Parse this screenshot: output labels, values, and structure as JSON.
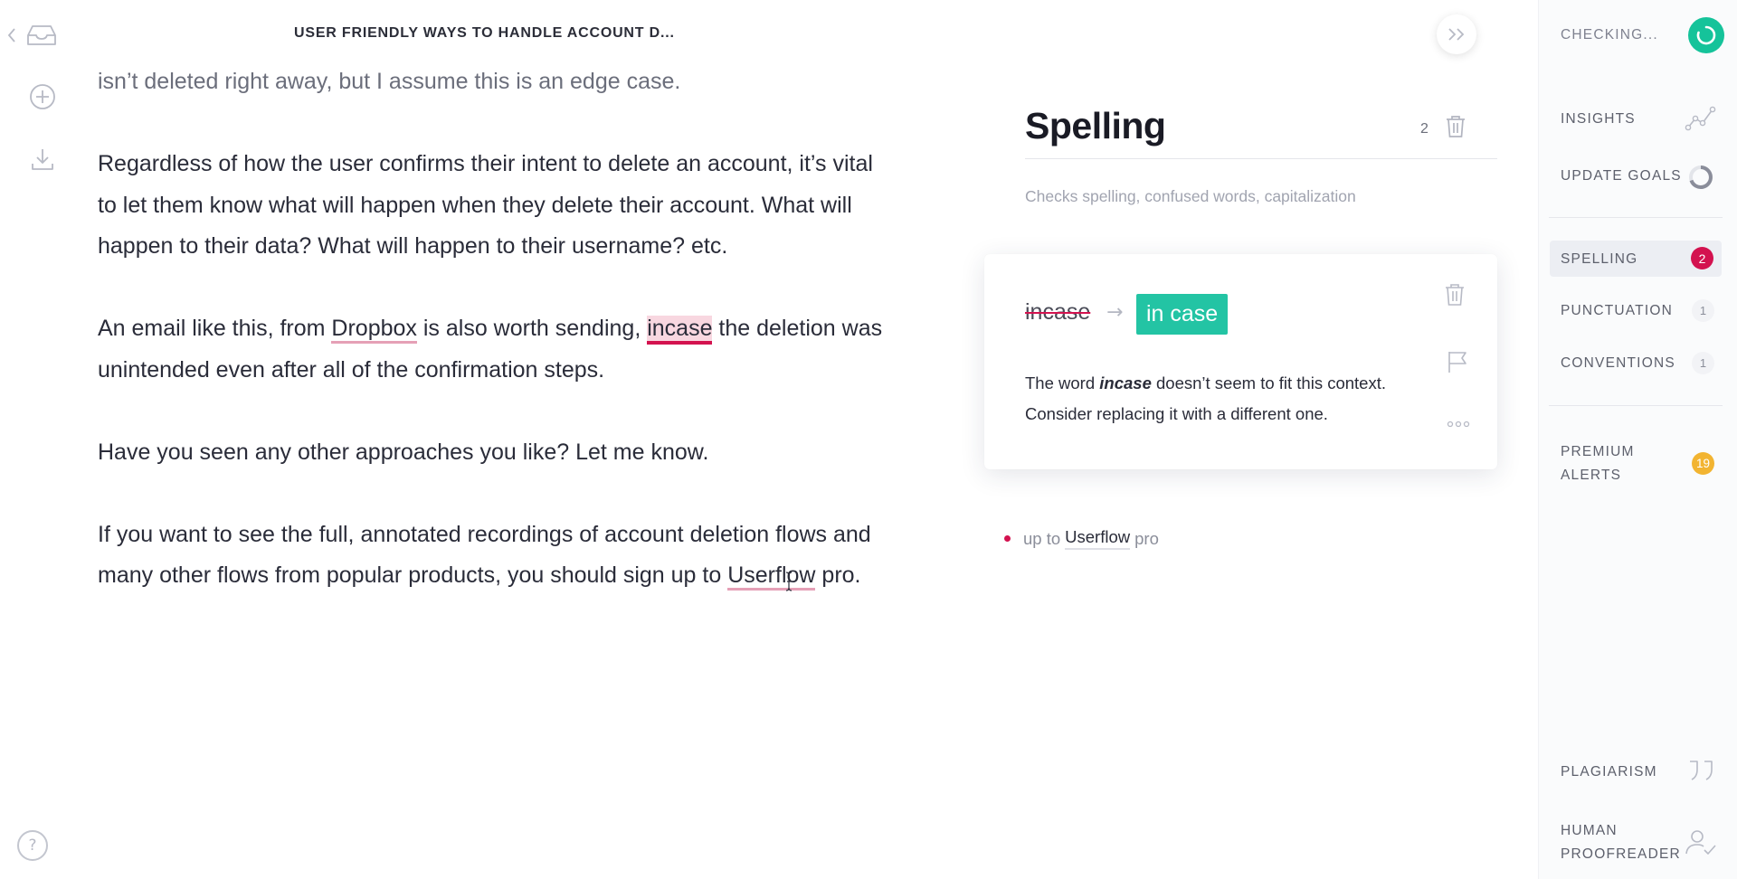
{
  "document": {
    "title": "USER FRIENDLY WAYS TO HANDLE ACCOUNT D...",
    "p0": "isn’t deleted right away, but I assume this is an edge case.",
    "p1": "Regardless of how the user confirms their intent to delete an account, it’s vital to let them know what will happen when they delete their account. What will happen to their data? What will happen to their username? etc.",
    "p2_a": "An email like this, from ",
    "p2_link": "Dropbox",
    "p2_b": " is also worth sending, ",
    "p2_err": "incase",
    "p2_c": " the deletion was unintended even after all of the confirmation steps.",
    "p3": "Have you seen any other approaches you like? Let me know.",
    "p4_a": "If you want to see the full, annotated recordings of account deletion flows and many other flows from popular products, you should sign up to ",
    "p4_link": "Userflow",
    "p4_b": " pro."
  },
  "left_rail": {
    "icons": [
      "back-icon",
      "inbox-icon",
      "add-icon",
      "download-icon",
      "help-icon"
    ],
    "help_label": "?"
  },
  "panel": {
    "title": "Spelling",
    "count": "2",
    "subtitle": "Checks spelling, confused words, capitalization",
    "card": {
      "wrong": "incase",
      "arrow": "→",
      "fix": "in case",
      "expl_a": "The word ",
      "expl_word": "incase",
      "expl_b": " doesn’t seem to fit this context. Consider replacing it with a different one."
    },
    "minor": {
      "pre": "up to",
      "word": "Userflow",
      "post": "pro"
    }
  },
  "sidebar": {
    "checking": "CHECKING...",
    "insights": "INSIGHTS",
    "update_goals": "UPDATE GOALS",
    "spelling": "SPELLING",
    "spelling_count": "2",
    "punctuation": "PUNCTUATION",
    "punctuation_count": "1",
    "conventions": "CONVENTIONS",
    "conventions_count": "1",
    "premium_a": "PREMIUM",
    "premium_b": "ALERTS",
    "premium_count": "19",
    "plagiarism": "PLAGIARISM",
    "human_a": "HUMAN",
    "human_b": "PROOFREADER"
  },
  "colors": {
    "accent_green": "#15c39a",
    "fix_teal": "#23c4a4",
    "error_red": "#d3124f",
    "premium_gold": "#f2b431"
  }
}
